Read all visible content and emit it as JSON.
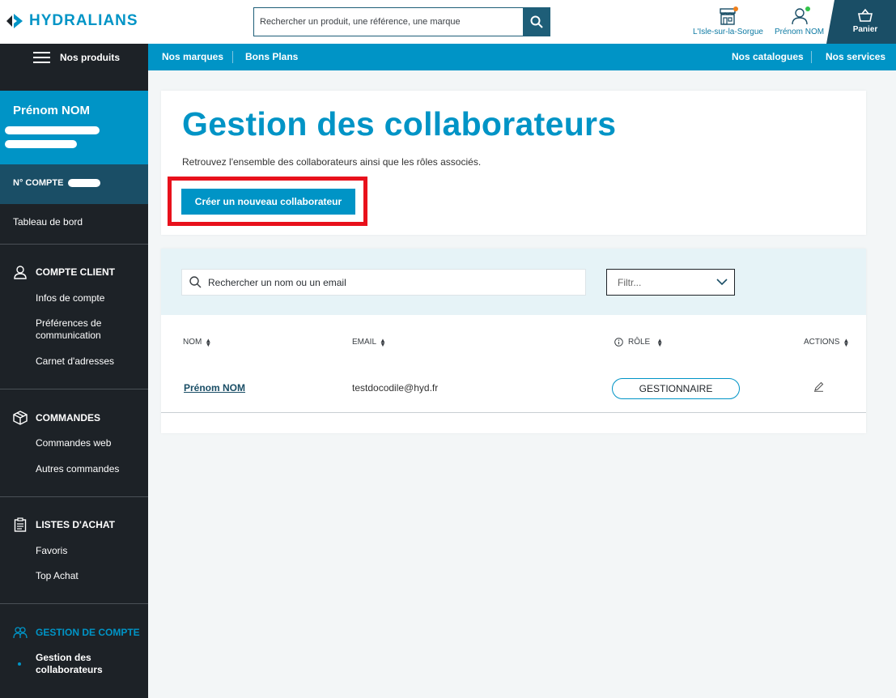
{
  "brand": {
    "name": "HYDRALIANS",
    "color": "#0094c6"
  },
  "header": {
    "search_placeholder": "Rechercher un produit, une référence, une marque",
    "store": {
      "label": "L'Isle-sur-la-Sorgue",
      "icon": "store-icon"
    },
    "account": {
      "label": "Prénom NOM",
      "icon": "user-icon"
    },
    "cart": {
      "label": "Panier",
      "icon": "basket-icon"
    }
  },
  "nav": {
    "products_label": "Nos produits",
    "links": [
      "Nos marques",
      "Bons Plans"
    ],
    "right_links": [
      "Nos catalogues",
      "Nos services"
    ]
  },
  "sidebar": {
    "user_name": "Prénom NOM",
    "account_label": "N° COMPTE",
    "dashboard": "Tableau de bord",
    "sections": [
      {
        "title": "COMPTE CLIENT",
        "icon": "user-outline-icon",
        "items": [
          "Infos de compte",
          "Préférences de communication",
          "Carnet d'adresses"
        ]
      },
      {
        "title": "COMMANDES",
        "icon": "package-icon",
        "items": [
          "Commandes web",
          "Autres commandes"
        ]
      },
      {
        "title": "LISTES D'ACHAT",
        "icon": "clipboard-icon",
        "items": [
          "Favoris",
          "Top Achat"
        ]
      },
      {
        "title": "GESTION DE COMPTE",
        "icon": "team-icon",
        "items": [
          "Gestion des collaborateurs"
        ]
      }
    ]
  },
  "main": {
    "title": "Gestion des collaborateurs",
    "subtitle": "Retrouvez l'ensemble des collaborateurs ainsi que les rôles associés.",
    "create_button": "Créer un nouveau collaborateur",
    "search_placeholder": "Rechercher un nom ou un email",
    "filter_placeholder": "Filtr...",
    "columns": {
      "name": "NOM",
      "email": "EMAIL",
      "role": "RÔLE",
      "actions": "ACTIONS"
    },
    "rows": [
      {
        "name": "Prénom NOM",
        "email": "testdocodile@hyd.fr",
        "role": "GESTIONNAIRE"
      }
    ]
  }
}
